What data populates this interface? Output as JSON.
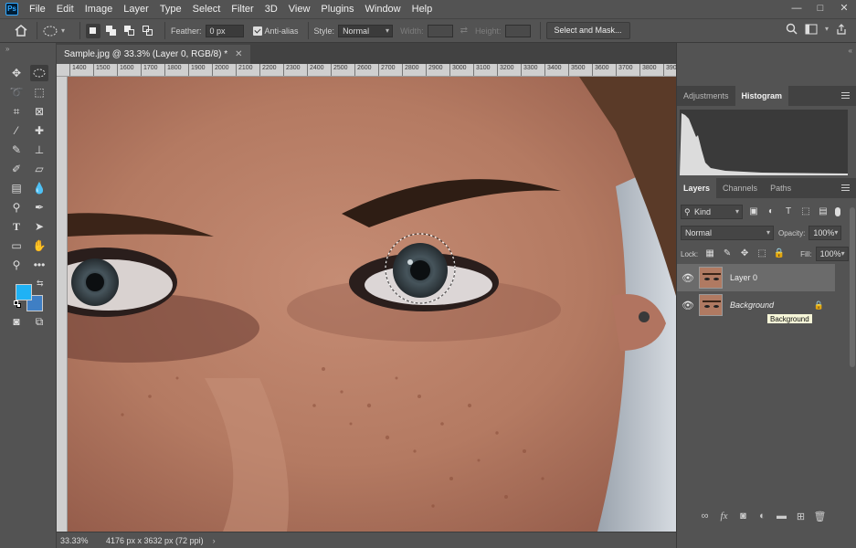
{
  "menu": {
    "logo": "Ps",
    "items": [
      "File",
      "Edit",
      "Image",
      "Layer",
      "Type",
      "Select",
      "Filter",
      "3D",
      "View",
      "Plugins",
      "Window",
      "Help"
    ]
  },
  "window_controls": {
    "minimize": "—",
    "maximize": "□",
    "close": "✕"
  },
  "options": {
    "feather_label": "Feather:",
    "feather_value": "0 px",
    "antialias_label": "Anti-alias",
    "style_label": "Style:",
    "style_value": "Normal",
    "width_label": "Width:",
    "height_label": "Height:",
    "select_mask_label": "Select and Mask..."
  },
  "document": {
    "tab_title": "Sample.jpg @ 33.3% (Layer 0, RGB/8) *",
    "close_glyph": "✕",
    "ruler_ticks": [
      "1400",
      "1500",
      "1600",
      "1700",
      "1800",
      "1900",
      "2000",
      "2100",
      "2200",
      "2300",
      "2400",
      "2500",
      "2600",
      "2700",
      "2800",
      "2900",
      "3000",
      "3100",
      "3200",
      "3300",
      "3400",
      "3500",
      "3600",
      "3700",
      "3800",
      "3900",
      "4000",
      "4100",
      "4200"
    ]
  },
  "status": {
    "zoom": "33.33%",
    "dimensions": "4176 px x 3632 px (72 ppi)"
  },
  "panels": {
    "top_tabs": [
      "Adjustments",
      "Histogram"
    ],
    "layers_tabs": [
      "Layers",
      "Channels",
      "Paths"
    ],
    "kind_label": "Kind",
    "blend_mode": "Normal",
    "opacity_label": "Opacity:",
    "opacity_value": "100%",
    "lock_label": "Lock:",
    "fill_label": "Fill:",
    "fill_value": "100%",
    "layers": [
      {
        "name": "Layer 0",
        "selected": true
      },
      {
        "name": "Background",
        "selected": false
      }
    ],
    "tooltip": "Background"
  },
  "colors": {
    "foreground": "#1fb2f5",
    "background": "#3f7fc4",
    "ui_bg": "#535353"
  }
}
